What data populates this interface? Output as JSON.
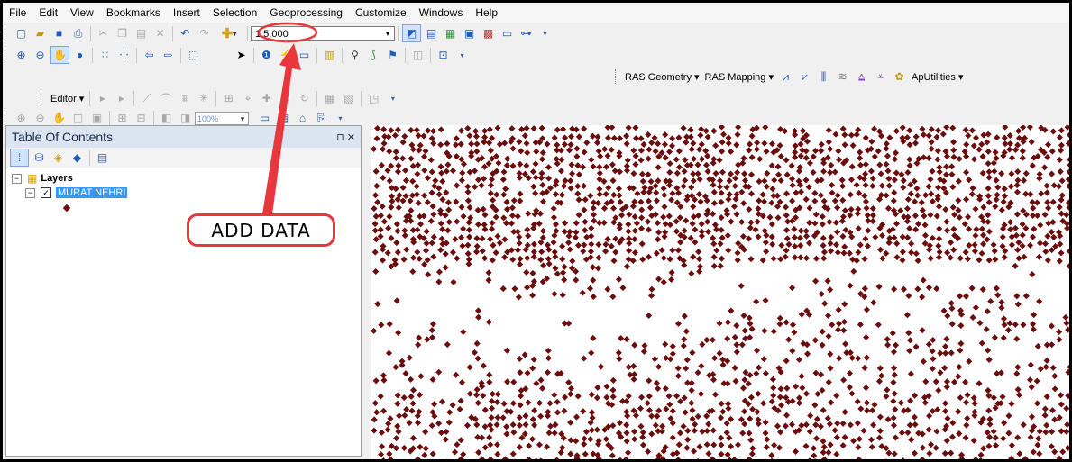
{
  "menu": [
    "File",
    "Edit",
    "View",
    "Bookmarks",
    "Insert",
    "Selection",
    "Geoprocessing",
    "Customize",
    "Windows",
    "Help"
  ],
  "toolbar": {
    "scale_value": "1:5,000",
    "ras_geometry": "RAS Geometry",
    "ras_mapping": "RAS Mapping",
    "aputilities": "ApUtilities",
    "editor": "Editor",
    "zoom_value": "100%"
  },
  "toc": {
    "title": "Table Of Contents",
    "root_label": "Layers",
    "layer_name": "MURAT NEHRI"
  },
  "annotation": {
    "label": "ADD DATA",
    "color": "#e8383d"
  },
  "map": {
    "point_color": "#6b0d0d"
  },
  "colors": {
    "toc_header_bg": "#dbe4f1",
    "selection": "#3399ff"
  }
}
